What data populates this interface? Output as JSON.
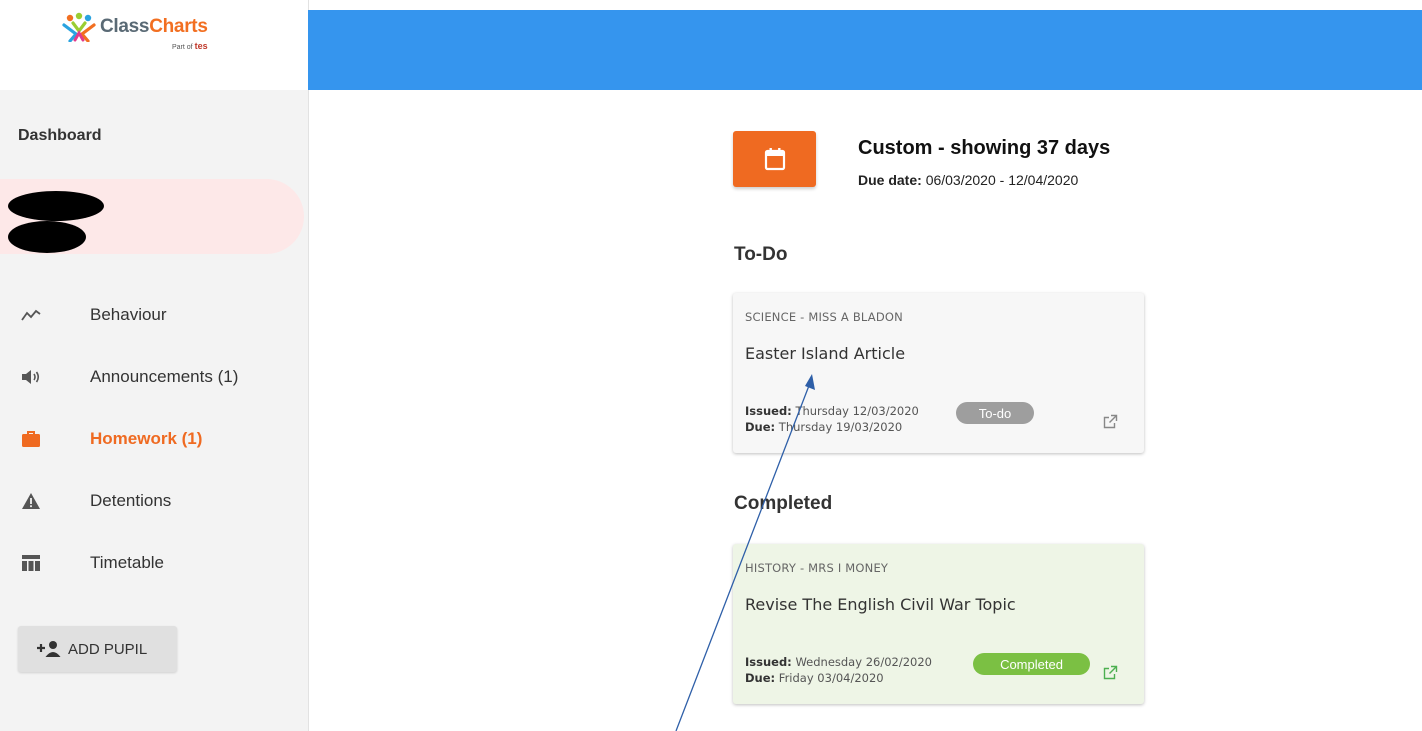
{
  "brand": {
    "name_part1": "Class",
    "name_part2": "Charts",
    "tagline_prefix": "Part of",
    "tagline_brand": "tes"
  },
  "sidebar": {
    "title": "Dashboard",
    "items": [
      {
        "label": "Behaviour",
        "icon": "trend-line-icon",
        "active": false
      },
      {
        "label": "Announcements (1)",
        "icon": "speaker-icon",
        "active": false
      },
      {
        "label": "Homework (1)",
        "icon": "briefcase-icon",
        "active": true
      },
      {
        "label": "Detentions",
        "icon": "warning-icon",
        "active": false
      },
      {
        "label": "Timetable",
        "icon": "table-icon",
        "active": false
      }
    ],
    "add_pupil_label": "ADD PUPIL"
  },
  "colors": {
    "header": "#3595ee",
    "accent": "#ef6a21",
    "todo_badge": "#9e9e9e",
    "completed_badge": "#7bc043",
    "active_pupil": "#fde8e8"
  },
  "filter": {
    "title": "Custom - showing 37 days",
    "due_label": "Due date:",
    "due_range": "06/03/2020 - 12/04/2020"
  },
  "todo": {
    "heading": "To-Do",
    "items": [
      {
        "subject": "SCIENCE - MISS A BLADON",
        "title": "Easter Island Article",
        "issued_label": "Issued:",
        "issued": "Thursday 12/03/2020",
        "due_label": "Due:",
        "due": "Thursday 19/03/2020",
        "status": "To-do"
      }
    ]
  },
  "completed": {
    "heading": "Completed",
    "items": [
      {
        "subject": "HISTORY - MRS I MONEY",
        "title": "Revise The English Civil War Topic",
        "issued_label": "Issued:",
        "issued": "Wednesday 26/02/2020",
        "due_label": "Due:",
        "due": "Friday 03/04/2020",
        "status": "Completed"
      }
    ]
  }
}
